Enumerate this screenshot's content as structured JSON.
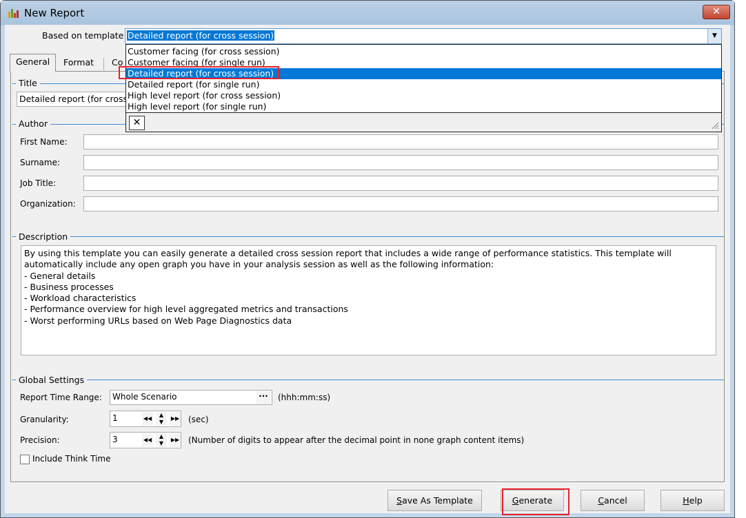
{
  "window": {
    "title": "New Report",
    "close_label": "✕"
  },
  "template": {
    "label": "Based on template",
    "value": "Detailed report (for cross session)",
    "options": [
      "Customer facing (for cross session)",
      "Customer facing (for single run)",
      "Detailed report (for cross session)",
      "Detailed report (for single run)",
      "High level report (for cross session)",
      "High level report (for single run)"
    ],
    "selected_index": 2,
    "dropdown_close": "✕"
  },
  "tabs": [
    {
      "label": "General"
    },
    {
      "label": "Format"
    },
    {
      "label": "Co"
    }
  ],
  "title_group": {
    "label": "Title",
    "value": "Detailed report (for cross"
  },
  "author": {
    "label": "Author",
    "first_name": "First Name:",
    "surname": "Surname:",
    "job_title": "Job Title:",
    "organization": "Organization:"
  },
  "description": {
    "label": "Description",
    "lines": [
      "By using this template you can easily generate a detailed cross session report that includes a wide range of performance statistics. This template will automatically include any open graph you have in your analysis session as well as the following information:",
      "- General details",
      "- Business processes",
      "- Workload characteristics",
      "- Performance overview for high level aggregated metrics and transactions",
      "- Worst performing URLs based on Web Page Diagnostics data"
    ]
  },
  "global": {
    "label": "Global Settings",
    "time_range_label": "Report Time Range:",
    "time_range_value": "Whole Scenario",
    "time_range_button": "···",
    "time_unit": "(hhh:mm:ss)",
    "granularity_label": "Granularity:",
    "granularity_value": "1",
    "granularity_unit": "(sec)",
    "precision_label": "Precision:",
    "precision_value": "3",
    "precision_unit": "(Number of digits to appear after the decimal point in none graph content items)",
    "think_time_label": "Include Think Time",
    "think_time_checked": false
  },
  "buttons": {
    "save_first": "S",
    "save_rest": "ave As Template",
    "generate_first": "G",
    "generate_rest": "enerate",
    "cancel_first": "C",
    "cancel_rest": "ancel",
    "help_first": "H",
    "help_rest": "elp"
  },
  "colors": {
    "selection": "#0078d7",
    "highlight_box": "#e8202a",
    "group_line": "#3c8ed6"
  }
}
